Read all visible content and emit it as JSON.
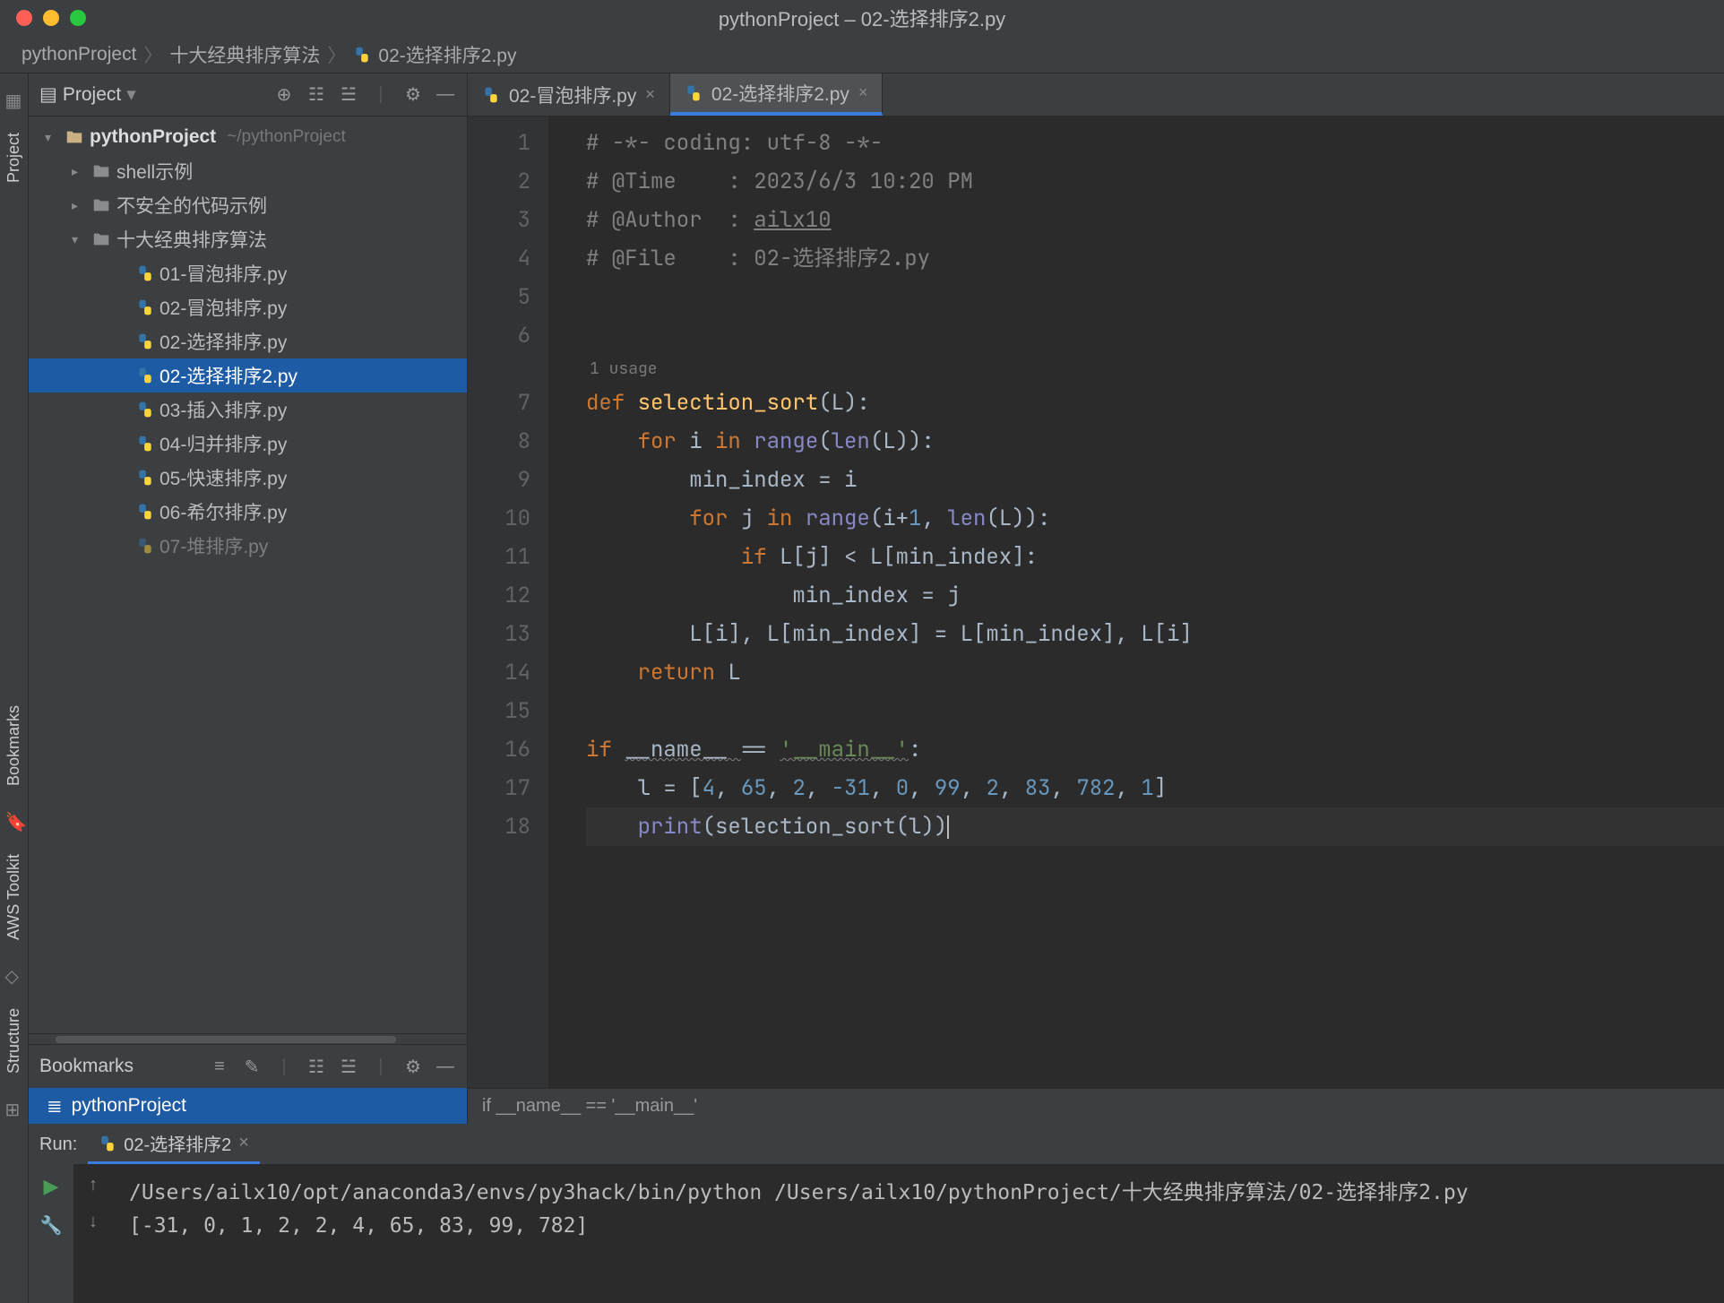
{
  "window": {
    "title": "pythonProject – 02-选择排序2.py"
  },
  "breadcrumb": {
    "root": "pythonProject",
    "folder": "十大经典排序算法",
    "file": "02-选择排序2.py"
  },
  "rails": {
    "project": "Project",
    "bookmarks": "Bookmarks",
    "structure": "Structure",
    "aws": "AWS Toolkit"
  },
  "project_panel": {
    "header": "Project",
    "root_name": "pythonProject",
    "root_path": "~/pythonProject",
    "folders": {
      "shell": "shell示例",
      "unsafe": "不安全的代码示例",
      "sorts": "十大经典排序算法"
    },
    "files": {
      "f1": "01-冒泡排序.py",
      "f2": "02-冒泡排序.py",
      "f3": "02-选择排序.py",
      "f4": "02-选择排序2.py",
      "f5": "03-插入排序.py",
      "f6": "04-归并排序.py",
      "f7": "05-快速排序.py",
      "f8": "06-希尔排序.py",
      "f9": "07-堆排序.py"
    }
  },
  "bookmarks": {
    "header": "Bookmarks",
    "item1": "pythonProject"
  },
  "tabs": {
    "t1": "02-冒泡排序.py",
    "t2": "02-选择排序2.py"
  },
  "code": {
    "usage": "1 usage",
    "l1": "# -*- coding: utf-8 -*-",
    "l2a": "# @Time    : ",
    "l2b": "2023/6/3 10:20 PM",
    "l3a": "# @Author  : ",
    "l3b": "ailx10",
    "l4a": "# @File    : ",
    "l4b": "02-选择排序2.py",
    "l7a": "def ",
    "l7b": "selection_sort",
    "l7c": "(L):",
    "l8a": "    for ",
    "l8b": "i ",
    "l8c": "in ",
    "l8d": "range",
    "l8e": "(",
    "l8f": "len",
    "l8g": "(L)):",
    "l9": "        min_index = i",
    "l10a": "        for ",
    "l10b": "j ",
    "l10c": "in ",
    "l10d": "range",
    "l10e": "(i+",
    "l10f": "1",
    "l10g": ", ",
    "l10h": "len",
    "l10i": "(L)):",
    "l11a": "            if ",
    "l11b": "L[j] < L[min_index]:",
    "l12": "                min_index = j",
    "l13": "        L[i], L[min_index] = L[min_index], L[i]",
    "l14a": "    return ",
    "l14b": "L",
    "l16a": "if ",
    "l16b": "__name__ ",
    "l16c": "== ",
    "l16d": "'__main__'",
    "l16e": ":",
    "l17a": "    l = [",
    "l17b": "4",
    "l17c": ", ",
    "l17d": "65",
    "l17e": ", ",
    "l17f": "2",
    "l17g": ", ",
    "l17h": "-31",
    "l17i": ", ",
    "l17j": "0",
    "l17k": ", ",
    "l17l": "99",
    "l17m": ", ",
    "l17n": "2",
    "l17o": ", ",
    "l17p": "83",
    "l17q": ", ",
    "l17r": "782",
    "l17s": ", ",
    "l17t": "1",
    "l17u": "]",
    "l18a": "    ",
    "l18b": "print",
    "l18c": "(selection_sort(l))"
  },
  "line_numbers": {
    "n1": "1",
    "n2": "2",
    "n3": "3",
    "n4": "4",
    "n5": "5",
    "n6": "6",
    "n7": "7",
    "n8": "8",
    "n9": "9",
    "n10": "10",
    "n11": "11",
    "n12": "12",
    "n13": "13",
    "n14": "14",
    "n15": "15",
    "n16": "16",
    "n17": "17",
    "n18": "18"
  },
  "breadcrumb_bottom": "if __name__ == '__main__'",
  "run": {
    "label": "Run:",
    "config": "02-选择排序2",
    "out_line1": "/Users/ailx10/opt/anaconda3/envs/py3hack/bin/python /Users/ailx10/pythonProject/十大经典排序算法/02-选择排序2.py",
    "out_line2": "[-31, 0, 1, 2, 2, 4, 65, 83, 99, 782]"
  }
}
